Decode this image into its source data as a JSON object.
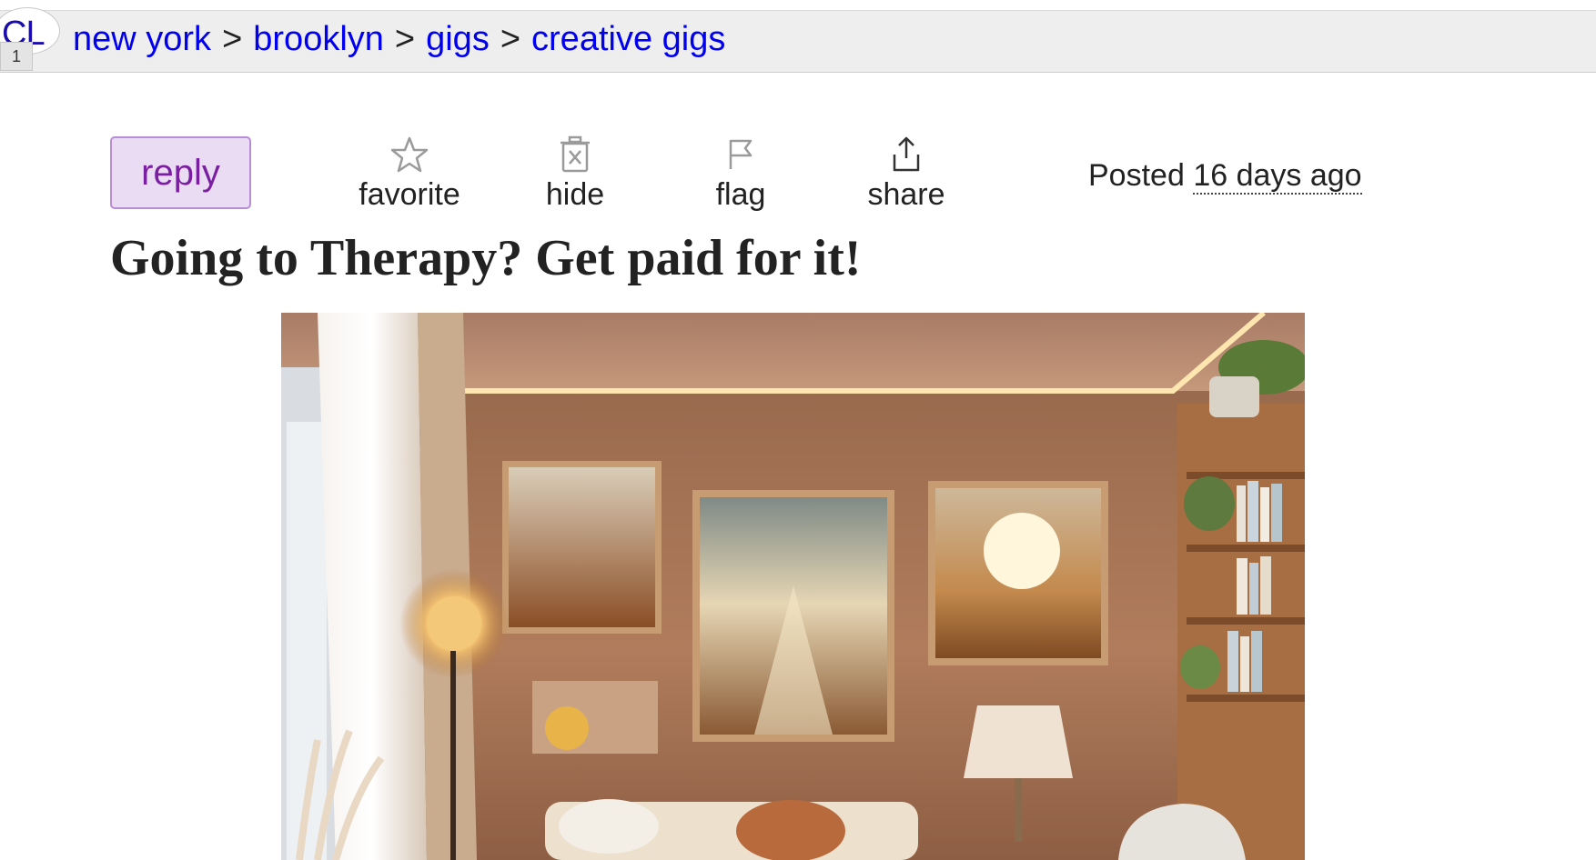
{
  "header": {
    "logo_text": "CL",
    "badge_text": "1",
    "breadcrumb": [
      {
        "label": "new york"
      },
      {
        "label": "brooklyn"
      },
      {
        "label": "gigs"
      },
      {
        "label": "creative gigs"
      }
    ],
    "separator": ">"
  },
  "actions": {
    "reply_label": "reply",
    "favorite_label": "favorite",
    "hide_label": "hide",
    "flag_label": "flag",
    "share_label": "share"
  },
  "posted": {
    "prefix": "Posted",
    "ago": "16 days ago"
  },
  "post": {
    "title": "Going to Therapy? Get paid for it!"
  },
  "colors": {
    "link": "#0000ee",
    "reply_bg": "#eadcf3",
    "reply_text": "#7a1fa2",
    "topbar_bg": "#eeeeee"
  },
  "icons": [
    "star-icon",
    "trash-icon",
    "flag-icon",
    "share-icon"
  ]
}
